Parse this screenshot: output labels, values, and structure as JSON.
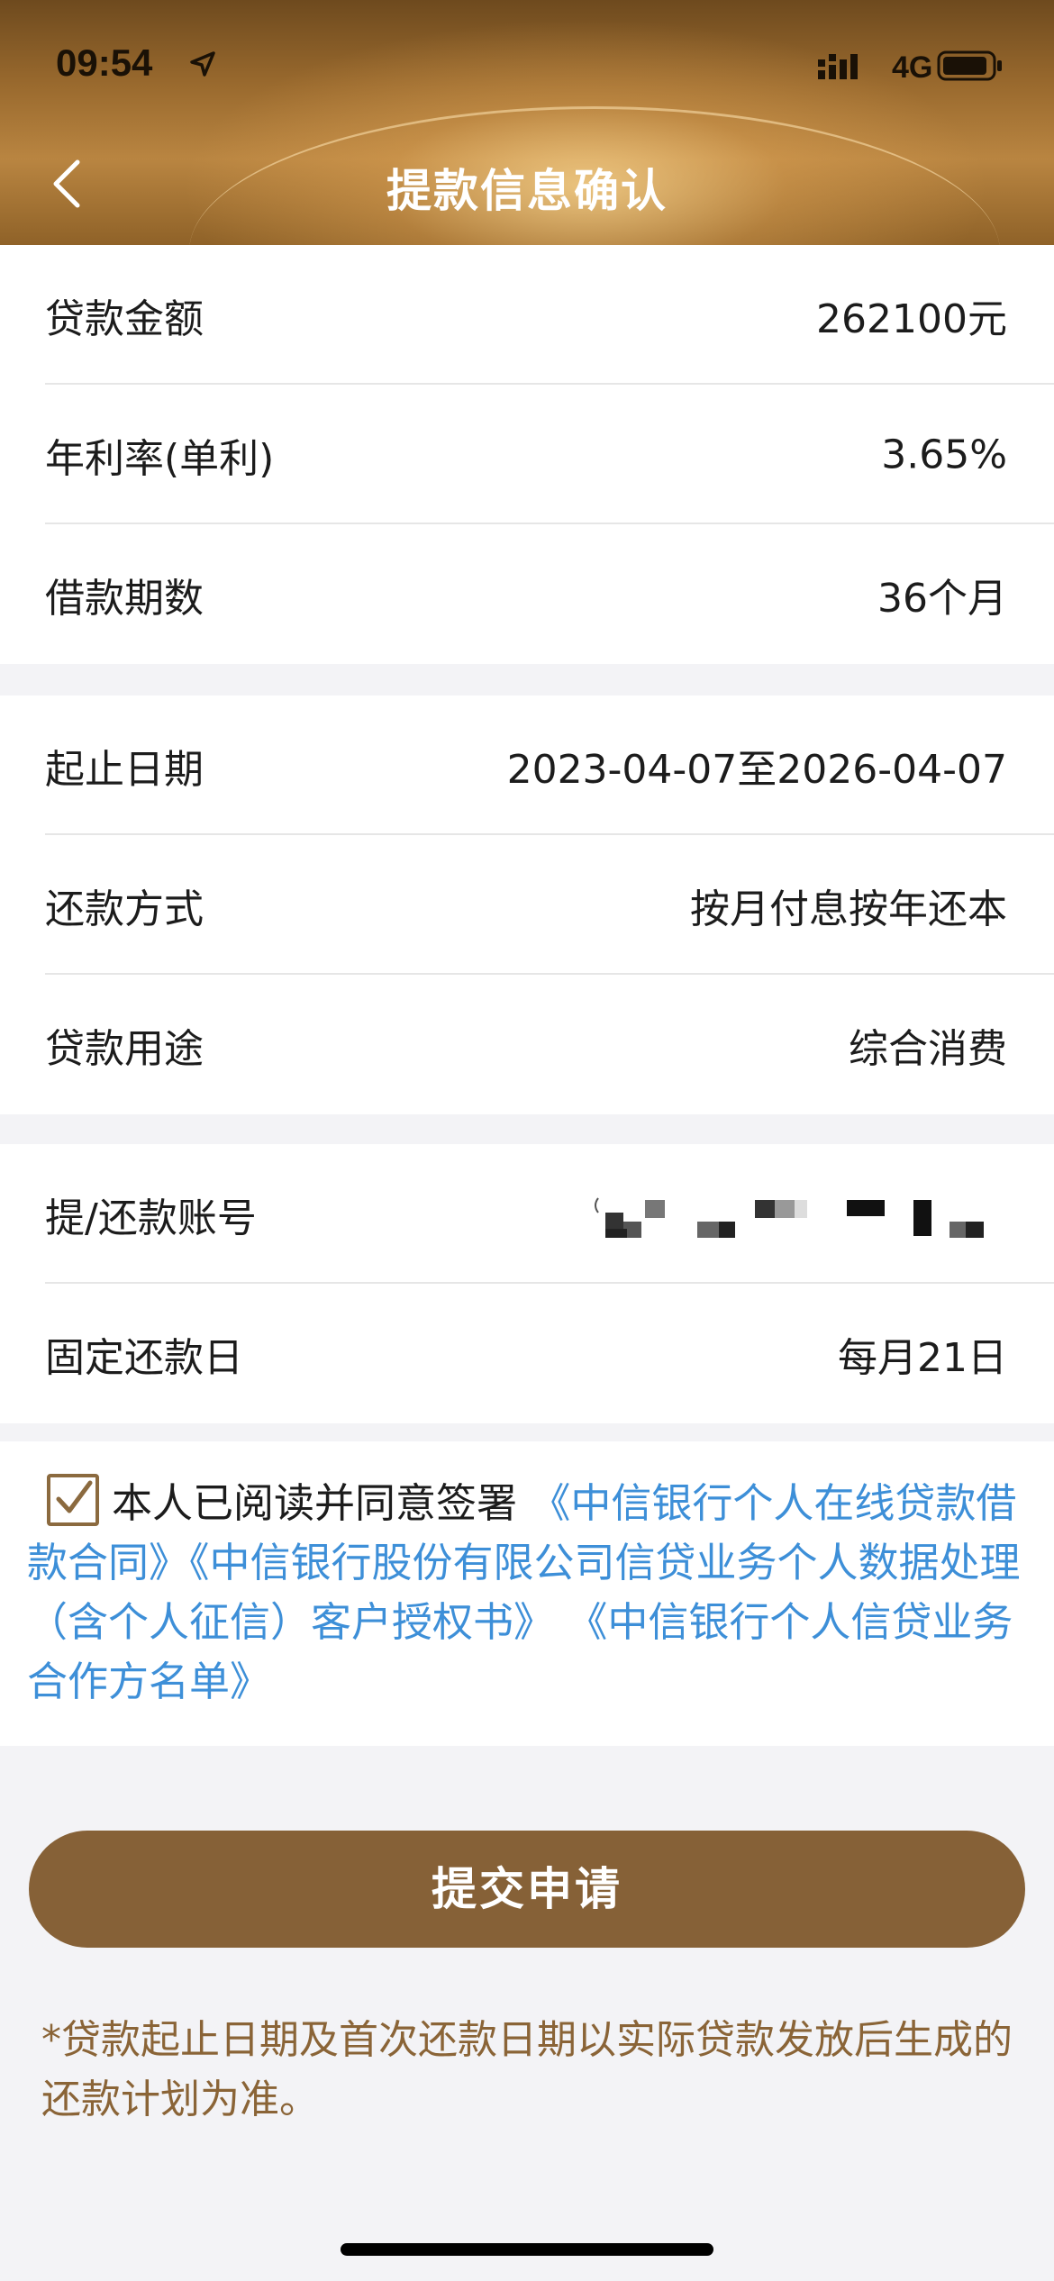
{
  "status_bar": {
    "time": "09:54",
    "network": "4G",
    "icons": [
      "location-arrow-icon",
      "signal-icon",
      "battery-icon"
    ]
  },
  "header": {
    "title": "提款信息确认",
    "back_icon": "chevron-left-icon"
  },
  "loan_section": {
    "rows": [
      {
        "label": "贷款金额",
        "value": "262100元"
      },
      {
        "label": "年利率(单利)",
        "value": "3.65%"
      },
      {
        "label": "借款期数",
        "value": "36个月"
      }
    ]
  },
  "repay_section": {
    "rows": [
      {
        "label": "起止日期",
        "value": "2023-04-07至2026-04-07"
      },
      {
        "label": "还款方式",
        "value": "按月付息按年还本"
      },
      {
        "label": "贷款用途",
        "value": "综合消费"
      }
    ]
  },
  "account_section": {
    "rows": [
      {
        "label": "提/还款账号",
        "value": ""
      },
      {
        "label": "固定还款日",
        "value": "每月21日"
      }
    ]
  },
  "agreement": {
    "checked": true,
    "prefix": "本人已阅读并同意签署",
    "links": [
      "《中信银行个人在线贷款借款合同》",
      "《中信银行股份有限公司信贷业务个人数据处理（含个人征信）客户授权书》",
      "《中信银行个人信贷业务合作方名单》"
    ]
  },
  "submit_label": "提交申请",
  "note": "*贷款起止日期及首次还款日期以实际贷款发放后生成的还款计划为准。",
  "colors": {
    "brand": "#866137",
    "link": "#3d8fd8",
    "note": "#8a6437"
  }
}
